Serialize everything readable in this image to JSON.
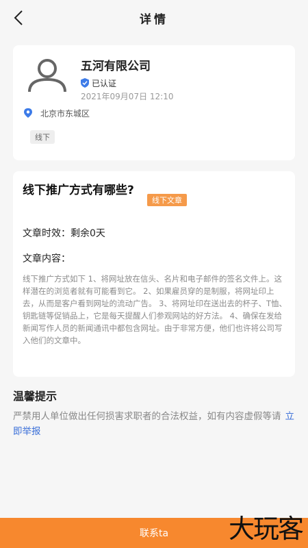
{
  "header": {
    "title": "详情"
  },
  "company": {
    "name": "五河有限公司",
    "verified_label": "已认证",
    "datetime": "2021年09月07日 12:10",
    "location": "北京市东城区",
    "tag": "线下",
    "colors": {
      "verified": "#3d7be8",
      "location": "#3d7be8"
    }
  },
  "article": {
    "title": "线下推广方式有哪些?",
    "tag": "线下文章",
    "validity": "文章时效：剩余0天",
    "content_label": "文章内容：",
    "content": "线下推广方式如下 1、将网址放在信头、名片和电子邮件的签名文件上。这样潜在的浏览者就有可能看到它。 2、如果雇员穿的是制服，将网址印上去，从而是客户看到网址的流动广告。 3、将网址印在送出去的杯子、T恤、钥匙链等促销品上，它是每天提醒人们参观网站的好方法。 4、确保在发给新闻写作人员的新闻通讯中都包含网址。由于非常方便，他们也许将公司写入他们的文章中。"
  },
  "tips": {
    "title": "温馨提示",
    "text": "严禁用人单位做出任何损害求职者的合法权益，如有内容虚假等请",
    "link": "立即举报"
  },
  "footer": {
    "contact_label": "联系ta",
    "watermark": "大玩客",
    "accent": "#f7882e"
  }
}
